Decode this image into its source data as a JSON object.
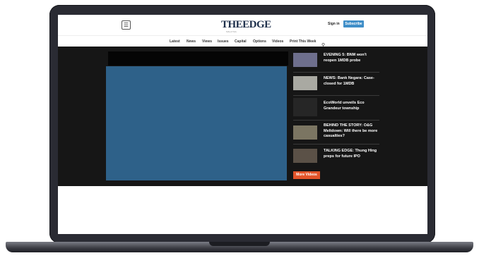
{
  "header": {
    "menu_icon": "hamburger-icon",
    "logo_text": "THEEDGE",
    "logo_sub": "MALAYSIA",
    "signin_label": "Sign in",
    "subscribe_label": "Subscribe"
  },
  "nav": {
    "items": [
      {
        "label": "Latest"
      },
      {
        "label": "News"
      },
      {
        "label": "Views"
      },
      {
        "label": "Issues"
      },
      {
        "label": "Capital"
      },
      {
        "label": "Options"
      },
      {
        "label": "Videos"
      },
      {
        "label": "Print This Week"
      }
    ],
    "search_icon": "search-icon"
  },
  "sidebar": {
    "items": [
      {
        "title": "EVENING 5: BNM won't reopen 1MDB probe",
        "thumb_color": "#6e6f8d"
      },
      {
        "title": "NEWS: Bank Negara: Case-closed for 1MDB",
        "thumb_color": "#a9a9a2"
      },
      {
        "title": "EcoWorld unveils Eco Grandeur township",
        "thumb_color": "#262626"
      },
      {
        "title": "BEHIND THE STORY: O&G Meltdown: Will there be more casualties?",
        "thumb_color": "#7b7562"
      },
      {
        "title": "TALKING EDGE: Thung Hing preps for future IPO",
        "thumb_color": "#5b5147"
      }
    ],
    "more_label": "More Videos"
  },
  "colors": {
    "band": "#161616",
    "player": "#2e6189",
    "subscribe": "#3f8ec8",
    "more_button": "#e3542a"
  }
}
